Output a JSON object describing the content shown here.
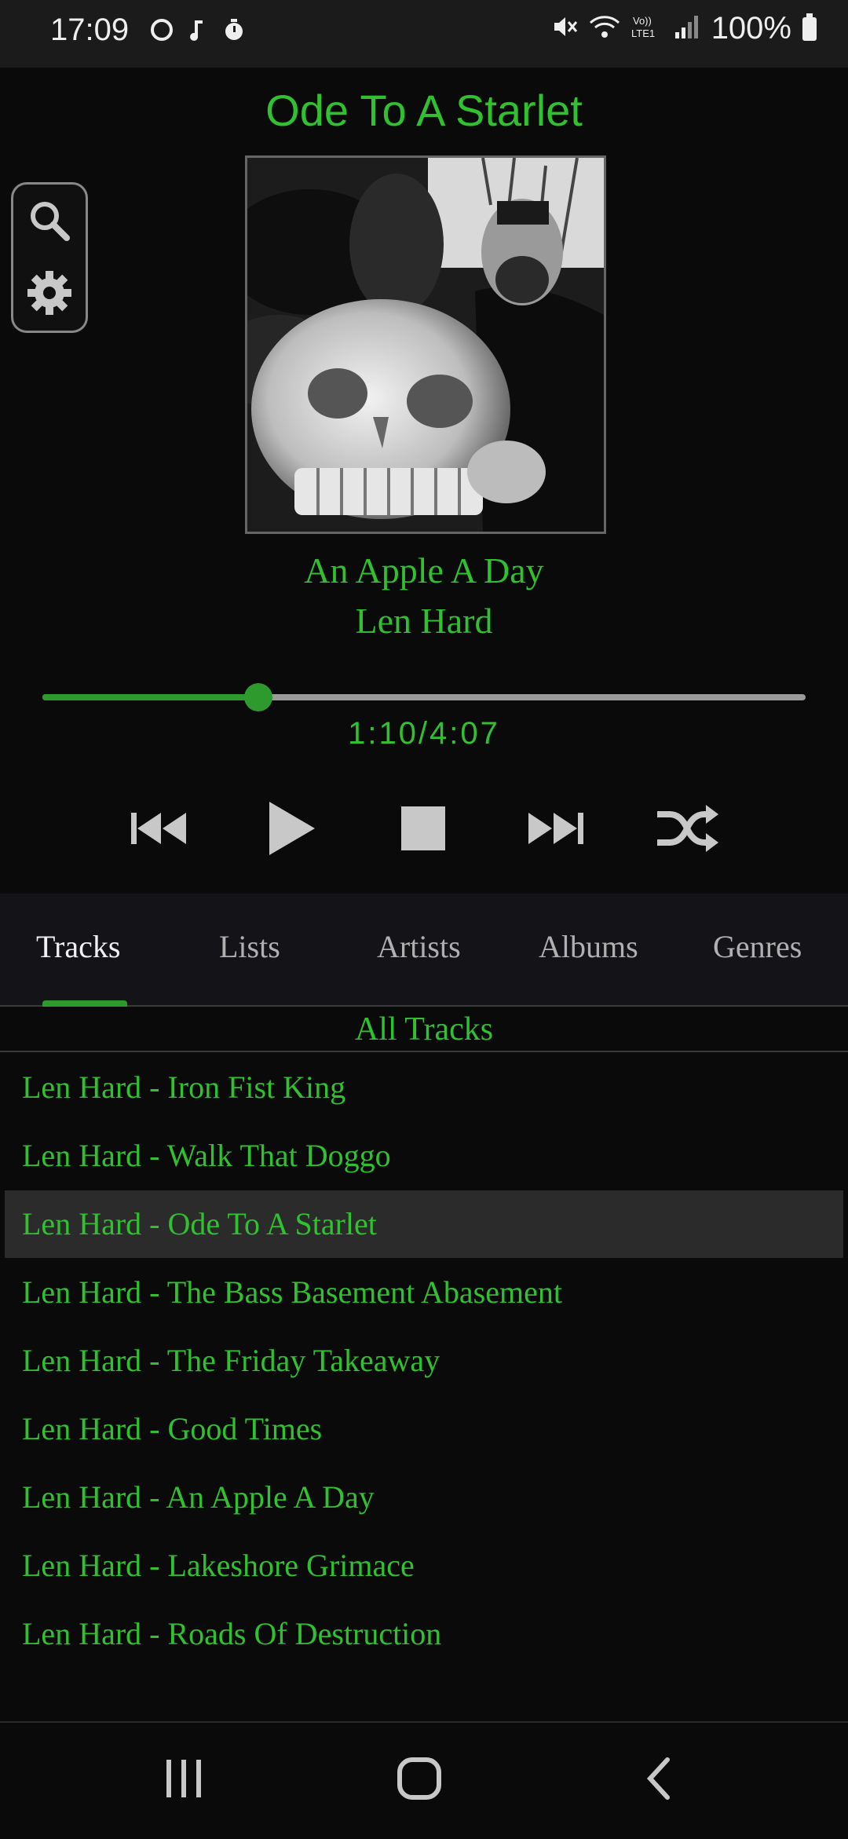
{
  "status_bar": {
    "time": "17:09",
    "battery": "100%",
    "icons": [
      "chat-bubble-icon",
      "music-note-icon",
      "timer-icon",
      "mute-icon",
      "wifi-icon",
      "volte-icon",
      "signal-icon",
      "battery-icon"
    ]
  },
  "now_playing": {
    "title": "Ode To A Starlet",
    "album": "An Apple A Day",
    "artist": "Len Hard",
    "time_display": "1:10/4:07",
    "progress_fraction": 0.283
  },
  "tools": [
    "search-icon",
    "gear-icon"
  ],
  "transport": [
    "previous-icon",
    "play-icon",
    "stop-icon",
    "next-icon",
    "shuffle-icon"
  ],
  "tabs": [
    {
      "label": "Tracks",
      "active": true
    },
    {
      "label": "Lists",
      "active": false
    },
    {
      "label": "Artists",
      "active": false
    },
    {
      "label": "Albums",
      "active": false
    },
    {
      "label": "Genres",
      "active": false
    }
  ],
  "list_header": "All Tracks",
  "tracks": [
    "Len Hard - Iron Fist King",
    "Len Hard - Walk That Doggo",
    "Len Hard - Ode To A Starlet",
    "Len Hard - The Bass Basement Abasement",
    "Len Hard - The Friday Takeaway",
    "Len Hard - Good Times",
    "Len Hard - An Apple A Day",
    "Len Hard - Lakeshore Grimace",
    "Len Hard - Roads Of Destruction"
  ],
  "selected_track_index": 2,
  "colors": {
    "accent": "#30c030",
    "accent_dark": "#2e9a2e",
    "background": "#0a0a0a",
    "selected_row": "#2b2b2b"
  },
  "nav_buttons": [
    "recents-icon",
    "home-icon",
    "back-icon"
  ]
}
